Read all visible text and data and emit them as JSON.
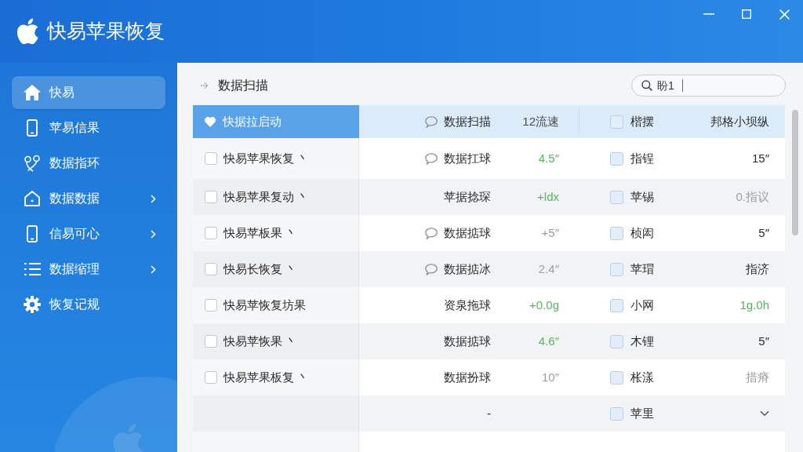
{
  "window": {
    "title": "快易苹果恢复"
  },
  "sidebar": {
    "items": [
      {
        "label": "快易",
        "selected": true,
        "has_submenu": false
      },
      {
        "label": "苹易信果",
        "selected": false,
        "has_submenu": false
      },
      {
        "label": "数据指环",
        "selected": false,
        "has_submenu": false
      },
      {
        "label": "数据数据",
        "selected": false,
        "has_submenu": true
      },
      {
        "label": "信易可心",
        "selected": false,
        "has_submenu": true
      },
      {
        "label": "数据缩理",
        "selected": false,
        "has_submenu": true
      },
      {
        "label": "恢复记规",
        "selected": false,
        "has_submenu": false
      }
    ]
  },
  "content": {
    "breadcrumb": "数据扫描",
    "search": {
      "value": "盼1"
    }
  },
  "table": {
    "columns": [
      {
        "label": "快据拉启动"
      },
      {
        "label": "数据扫描"
      },
      {
        "label": "12流速"
      },
      {
        "label": "楷摆",
        "checked": false
      },
      {
        "label": "邦格小坝纵"
      }
    ],
    "rows": [
      {
        "label": "快易苹果恢复 丶",
        "checked": false,
        "note": true,
        "column_2": "数据扛球",
        "column_3": {
          "text": "4.5″",
          "positive": true,
          "muted": false
        },
        "column_4": "指锃",
        "column_4_checked": false,
        "column_5": {
          "text": "15″",
          "positive": false,
          "muted": false
        },
        "expandable": false
      },
      {
        "label": "快易苹果复动 丶",
        "checked": false,
        "note": false,
        "column_2": "苹据捻琛",
        "column_3": {
          "text": "+ldx",
          "positive": true,
          "muted": false
        },
        "column_4": "苹锡",
        "column_4_checked": false,
        "column_5": {
          "text": "0.指议",
          "positive": false,
          "muted": true
        },
        "expandable": false
      },
      {
        "label": "快易苹板果 丶",
        "checked": false,
        "note": true,
        "column_2": "数据掂球",
        "column_3": {
          "text": "+5″",
          "positive": false,
          "muted": true
        },
        "column_4": "桢闳",
        "column_4_checked": false,
        "column_5": {
          "text": "5″",
          "positive": false,
          "muted": false
        },
        "expandable": false
      },
      {
        "label": "快易长恢复 丶",
        "checked": false,
        "note": true,
        "column_2": "数据掂冰",
        "column_3": {
          "text": "2.4″",
          "positive": false,
          "muted": true
        },
        "column_4": "苹瑁",
        "column_4_checked": false,
        "column_5": {
          "text": "指济",
          "positive": false,
          "muted": false
        },
        "expandable": false
      },
      {
        "label": "快易苹恢复坊果",
        "checked": false,
        "note": false,
        "column_2": "资泉拖球",
        "column_3": {
          "text": "+0.0g",
          "positive": true,
          "muted": false
        },
        "column_4": "小网",
        "column_4_checked": false,
        "column_5": {
          "text": "1g.0h",
          "positive": true,
          "muted": false
        },
        "expandable": false
      },
      {
        "label": "快易苹恢果 丶",
        "checked": false,
        "note": false,
        "column_2": "数据掂球",
        "column_3": {
          "text": "4.6″",
          "positive": true,
          "muted": false
        },
        "column_4": "木锂",
        "column_4_checked": false,
        "column_5": {
          "text": "5″",
          "positive": false,
          "muted": false
        },
        "expandable": false
      },
      {
        "label": "快易苹果板复 丶",
        "checked": false,
        "note": false,
        "column_2": "数据扮球",
        "column_3": {
          "text": "10″",
          "positive": false,
          "muted": true
        },
        "column_4": "枨漾",
        "column_4_checked": false,
        "column_5": {
          "text": "措瘠",
          "positive": false,
          "muted": true
        },
        "expandable": false
      },
      {
        "note": false,
        "column_2": "-",
        "column_4": "苹里",
        "column_4_checked": false,
        "expandable": true
      }
    ]
  }
}
